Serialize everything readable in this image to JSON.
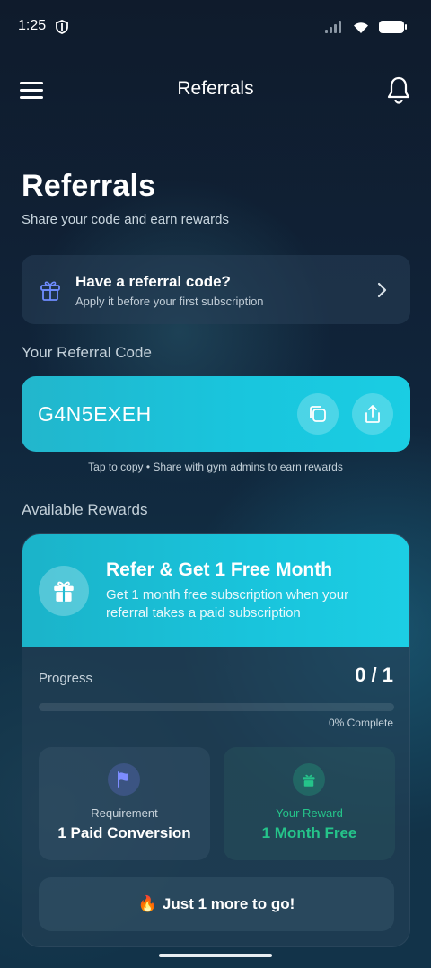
{
  "status_bar": {
    "time": "1:25"
  },
  "app_bar": {
    "title": "Referrals"
  },
  "header": {
    "title": "Referrals",
    "subtitle": "Share your code and earn rewards"
  },
  "referral_prompt": {
    "title": "Have a referral code?",
    "subtitle": "Apply it before your first subscription"
  },
  "code_section": {
    "label": "Your Referral Code",
    "code": "G4N5EXEH",
    "hint": "Tap to copy • Share with gym admins to earn rewards"
  },
  "rewards_section": {
    "label": "Available Rewards",
    "reward": {
      "title": "Refer & Get 1 Free Month",
      "description": "Get 1 month free subscription when your referral takes a paid subscription",
      "progress_label": "Progress",
      "progress_count": "0 / 1",
      "progress_fraction": 0,
      "progress_percent_text": "0% Complete",
      "requirement_label": "Requirement",
      "requirement_value": "1 Paid Conversion",
      "reward_label": "Your Reward",
      "reward_value": "1 Month Free",
      "cta_emoji": "🔥",
      "cta_text": "Just 1 more to go!"
    }
  },
  "colors": {
    "accent": "#1fc7dd",
    "success": "#25c48a",
    "background": "#10243a"
  },
  "icons": {
    "menu": "hamburger-menu-icon",
    "bell": "bell-icon",
    "gift": "gift-icon",
    "chevron": "chevron-right-icon",
    "copy": "copy-icon",
    "share": "share-icon",
    "flag": "flag-icon",
    "shield": "shield-icon"
  }
}
